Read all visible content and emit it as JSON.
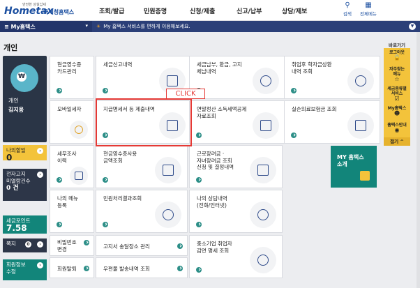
{
  "header": {
    "logo_small": "안전한 성실납세",
    "logo_main": "Hometax",
    "logo_kr": "국세청홈택스",
    "nav": [
      "조회/발급",
      "민원증명",
      "신청/제출",
      "신고/납부",
      "상담/제보"
    ],
    "search_label": "검색",
    "menu_label": "전체메뉴"
  },
  "subbar": {
    "mymenu": "My홈택스",
    "notice": "My 홈택스 서비스를 편하게 이용해보세요."
  },
  "page_title": "개인",
  "profile": {
    "role": "개인",
    "name": "김지웅"
  },
  "side": {
    "payment_discount": "나의할일",
    "payment_count": "0",
    "notice_title1": "전자고지",
    "notice_title2": "미열람건수",
    "notice_count": "0 건",
    "points_title": "세금포인트",
    "points_value": "7.58",
    "tax_due": "쪽지",
    "tax_due_count": "0",
    "member_info1": "회원정보",
    "member_info2": "수정"
  },
  "tiles": {
    "cash_receipt": "현금영수증\n카드관리",
    "tax_report_list": "세금신고내역",
    "tax_payment": "세금납부, 환급, 고지\n체납내역",
    "student_loan": "취업후 학자금상환\n내역 조회",
    "mobile_tax": "모바일세자",
    "payment_statement": "지급명세서 등 제출내역",
    "year_end": "연말정산 소득세액공제\n자료조회",
    "medical": "실손의료보험금 조회",
    "tax_audit": "세무조사\n이력",
    "cash_usage": "현금영수증사용\n금액조회",
    "labor_income": "근로장려금 ·\n자녀장려금 조회\n신청 및 결정내역",
    "my_menu": "나의 메뉴\n등록",
    "civil_result": "민원처리결과조회",
    "consult": "나의 상담내역\n(전화/인터넷)",
    "password": "비밀번호\n변경",
    "notice_place": "고지서 송달장소 관리",
    "sme_tax": "중소기업 취업자\n감면 명세 조회",
    "withdraw": "회원탈퇴",
    "mail_refuse": "우편물 발송내역 조회",
    "myhome_intro": "MY 홈택스\n소개"
  },
  "highlight_label": "CLICK",
  "quick": {
    "title": "바로가기",
    "items": [
      "로그아웃",
      "자주찾는\n메뉴",
      "세금종류별\n서비스",
      "My홈택스",
      "홈택스안내"
    ],
    "fold": "접기 ^"
  }
}
